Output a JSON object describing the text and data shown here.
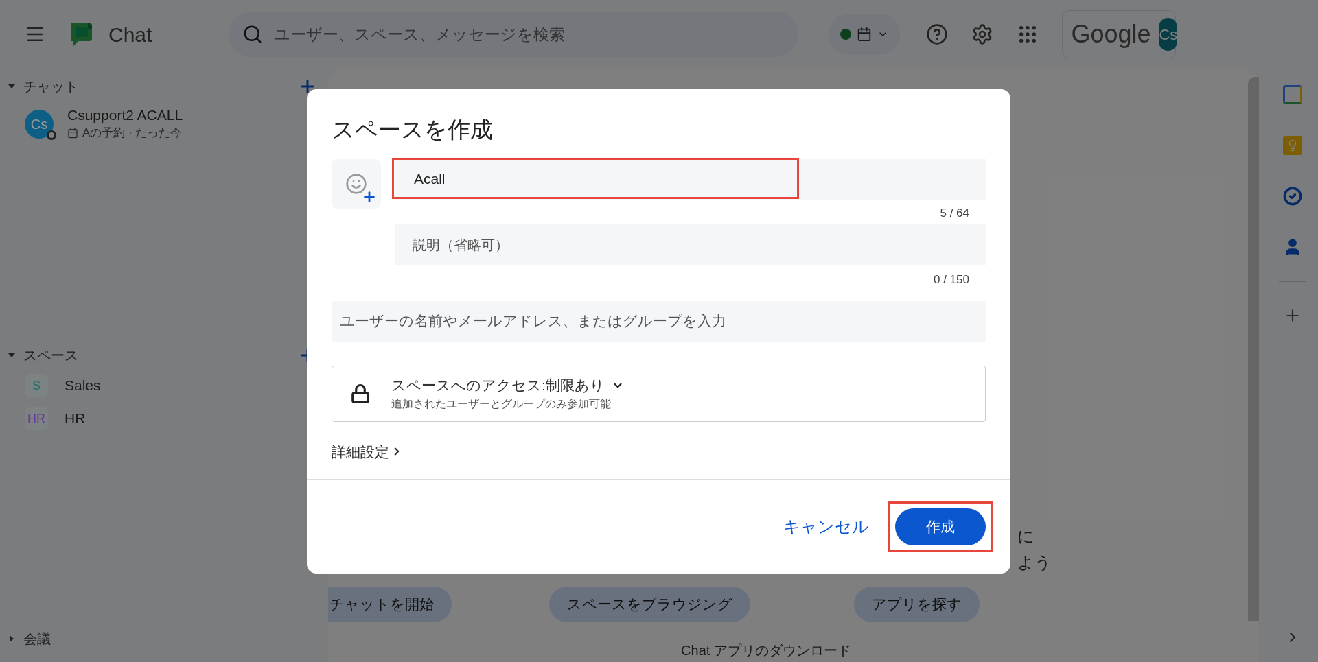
{
  "top_bar": {
    "app_name": "Chat",
    "search": {
      "placeholder": "ユーザー、スペース、メッセージを検索"
    },
    "brand": "Google",
    "avatar": "Cs"
  },
  "sidebar": {
    "sections": [
      {
        "title": "チャット",
        "expanded": true,
        "items": [
          {
            "kind": "dm",
            "name": "Csupport2 ACALL",
            "avatar": "Cs",
            "color": "#0e5f86",
            "subtitle": "Aの予約 · たった今"
          }
        ]
      },
      {
        "title": "スペース",
        "expanded": true,
        "items": [
          {
            "kind": "space",
            "name": "Sales",
            "avatar": "S",
            "color": "#1f6b6e"
          },
          {
            "kind": "space",
            "name": "HR",
            "avatar": "HR",
            "color": "#6a35a0"
          }
        ]
      },
      {
        "title": "会議",
        "expanded": false
      }
    ]
  },
  "main": {
    "fragments": [
      "に",
      "よう"
    ],
    "actions": [
      "チャットを開始",
      "スペースをブラウジング",
      "アプリを探す"
    ],
    "download_link": "Chat アプリのダウンロード"
  },
  "dialog": {
    "title": "スペースを作成",
    "name_field": {
      "value": "Acall",
      "highlighted": true
    },
    "name_counter": "5 / 64",
    "description_field": {
      "placeholder": "説明（省略可）"
    },
    "description_counter": "0 / 150",
    "members_field": {
      "placeholder": "ユーザーの名前やメールアドレス、またはグループを入力"
    },
    "access": {
      "title": "スペースへのアクセス:制限あり",
      "subtitle": "追加されたユーザーとグループのみ参加可能"
    },
    "advanced_link": "詳細設定",
    "buttons": [
      {
        "kind": "text",
        "label": "キャンセル",
        "highlighted": false
      },
      {
        "kind": "primary",
        "label": "作成",
        "highlighted": true
      }
    ]
  }
}
